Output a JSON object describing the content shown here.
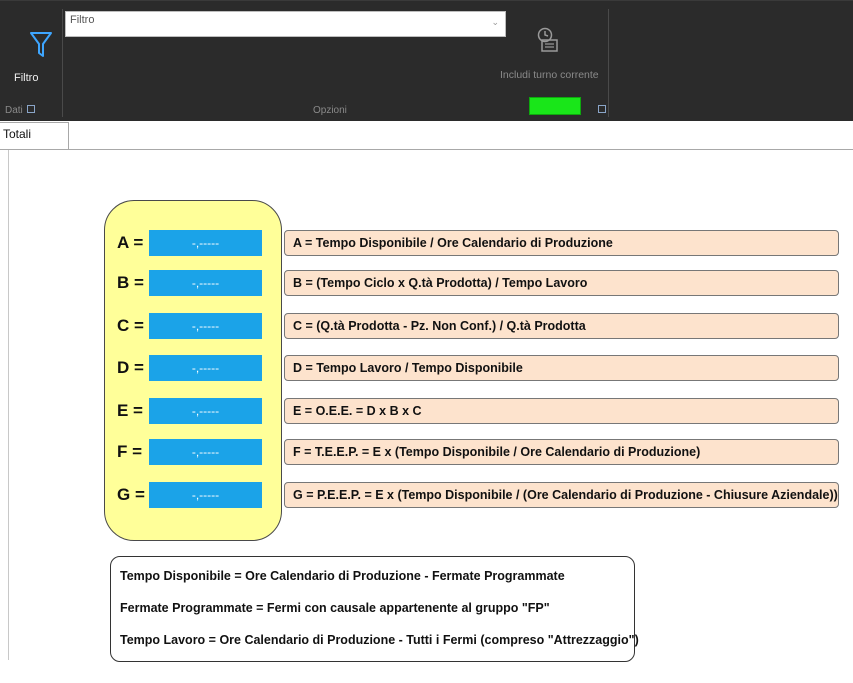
{
  "ribbon": {
    "filter_button_label": "Filtro",
    "filter_select_value": "Filtro",
    "include_shift_label": "Includi turno corrente",
    "group_labels": [
      "Dati",
      "Opzioni"
    ],
    "indicator_color": "#19e619"
  },
  "tabs": [
    {
      "label": "Totali"
    }
  ],
  "kpis": [
    {
      "key": "A =",
      "value": "-,-----",
      "formula": "A = Tempo Disponibile / Ore Calendario di Produzione"
    },
    {
      "key": "B =",
      "value": "-,-----",
      "formula": "B = (Tempo Ciclo x Q.tà Prodotta) / Tempo Lavoro"
    },
    {
      "key": "C =",
      "value": "-,-----",
      "formula": "C = (Q.tà Prodotta - Pz. Non Conf.) / Q.tà Prodotta"
    },
    {
      "key": "D =",
      "value": "-,-----",
      "formula": "D = Tempo Lavoro / Tempo Disponibile"
    },
    {
      "key": "E =",
      "value": "-,-----",
      "formula": "E = O.E.E. = D x B x C"
    },
    {
      "key": "F =",
      "value": "-,-----",
      "formula": "F = T.E.E.P. = E x (Tempo Disponibile / Ore Calendario di Produzione)"
    },
    {
      "key": "G =",
      "value": "-,-----",
      "formula": "G = P.E.E.P. = E x (Tempo Disponibile / (Ore Calendario di Produzione - Chiusure Aziendale))"
    }
  ],
  "legend": [
    "Tempo Disponibile = Ore Calendario di Produzione - Fermate Programmate",
    "Fermate Programmate = Fermi con causale appartenente al gruppo \"FP\"",
    "Tempo Lavoro = Ore Calendario di Produzione - Tutti i Fermi (compreso \"Attrezzaggio\")"
  ],
  "colors": {
    "ribbon_bg": "#2b2b2b",
    "kpi_value_bg": "#1ba3e8",
    "kpi_panel_bg": "#ffff99",
    "formula_bg": "#fde3cd"
  }
}
